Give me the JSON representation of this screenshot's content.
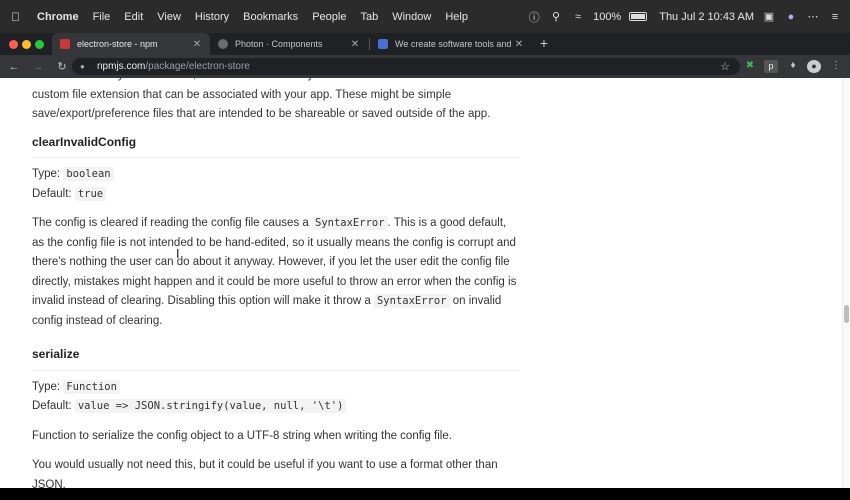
{
  "menubar": {
    "apple_icon": "apple-icon",
    "items": [
      "Chrome",
      "File",
      "Edit",
      "View",
      "History",
      "Bookmarks",
      "People",
      "Tab",
      "Window",
      "Help"
    ],
    "battery_percent": "100%",
    "datetime": "Thu Jul 2  10:43 AM"
  },
  "tabs": [
    {
      "title": "electron-store - npm",
      "favicon_color": "#cb3837",
      "active": true
    },
    {
      "title": "Photon · Components",
      "favicon_color": "#6b6b6b",
      "active": false
    },
    {
      "title": "We create software tools and ...",
      "favicon_color": "#4a6fd1",
      "active": false
    }
  ],
  "address_bar": {
    "host": "npmjs.com",
    "path": "/package/electron-store"
  },
  "page": {
    "intro_partial": "You would usually not need this, but could be useful if you want to interact with a file with a custom file extension that can be associated with your app. These might be simple save/export/preference files that are intended to be shareable or saved outside of the app.",
    "section1": {
      "heading": "clearInvalidConfig",
      "type_label": "Type:",
      "type_value": "boolean",
      "default_label": "Default:",
      "default_value": "true",
      "desc_part1": "The config is cleared if reading the config file causes a ",
      "desc_code1": "SyntaxError",
      "desc_part2": ". This is a good default, as the config file is not intended to be hand-edited, so it usually means the config is corrupt and there's nothing the user can do about it anyway. However, if you let the user edit the config file directly, mistakes might happen and it could be more useful to throw an error when the config is invalid instead of clearing. Disabling this option will make it throw a ",
      "desc_code2": "SyntaxError",
      "desc_part3": " on invalid config instead of clearing."
    },
    "section2": {
      "heading": "serialize",
      "type_label": "Type:",
      "type_value": "Function",
      "default_label": "Default:",
      "default_value": "value => JSON.stringify(value, null, '\\t')",
      "desc1": "Function to serialize the config object to a UTF-8 string when writing the config file.",
      "desc2": "You would usually not need this, but it could be useful if you want to use a format other than JSON."
    }
  },
  "scroll_position": 0.58
}
